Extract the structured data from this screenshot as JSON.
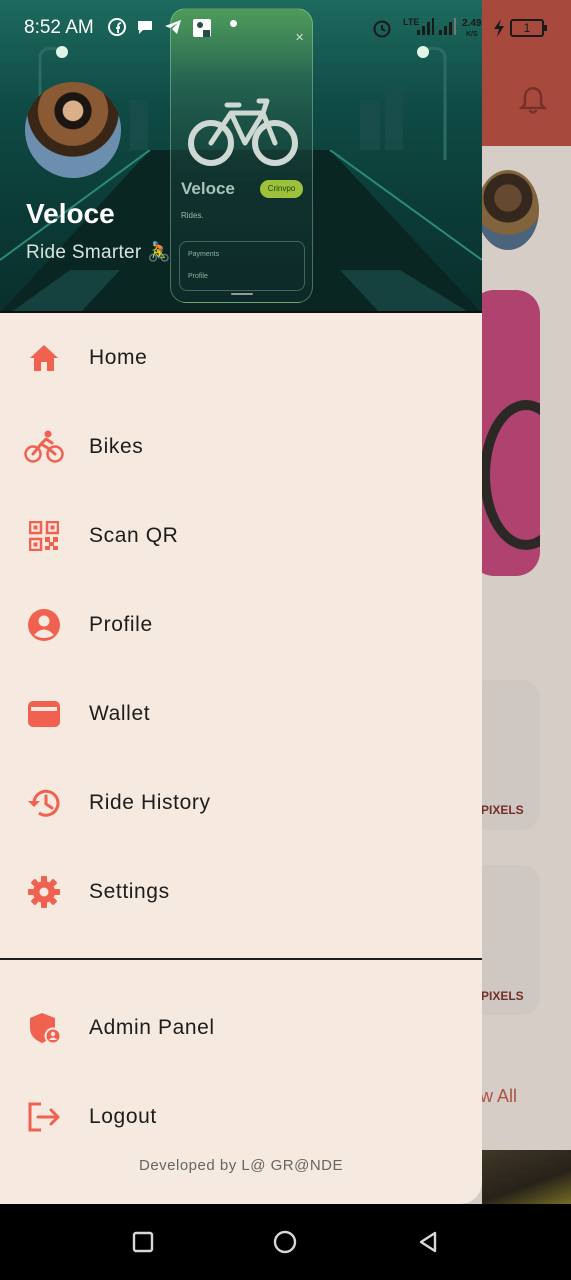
{
  "status_bar": {
    "time": "8:52 AM",
    "network_label": "LTE",
    "speed_value": "2.49",
    "speed_unit": "K/S",
    "battery_level": "1"
  },
  "drawer": {
    "app_name": "Veloce",
    "tagline": "Ride Smarter 🚴",
    "menu_items": [
      {
        "label": "Home",
        "icon": "home-icon"
      },
      {
        "label": "Bikes",
        "icon": "bike-icon"
      },
      {
        "label": "Scan QR",
        "icon": "qr-code-icon"
      },
      {
        "label": "Profile",
        "icon": "profile-icon"
      },
      {
        "label": "Wallet",
        "icon": "wallet-icon"
      },
      {
        "label": "Ride History",
        "icon": "history-icon"
      },
      {
        "label": "Settings",
        "icon": "gear-icon"
      }
    ],
    "secondary_items": [
      {
        "label": "Admin Panel",
        "icon": "admin-shield-icon"
      },
      {
        "label": "Logout",
        "icon": "logout-icon"
      }
    ],
    "footer": "Developed by L@ GR@NDE",
    "header_mock": {
      "title": "Veloce",
      "pill": "Crinvpo",
      "subtitle": "Rides.",
      "row1": "Payments",
      "row2": "Profile"
    }
  },
  "background": {
    "pixels_label_1": "PIXELS",
    "pixels_label_2": "PIXELS",
    "view_all": "w All"
  },
  "colors": {
    "accent": "#f0614f",
    "drawer_bg": "#f5e9e0",
    "header_dark": "#0b3a36"
  }
}
